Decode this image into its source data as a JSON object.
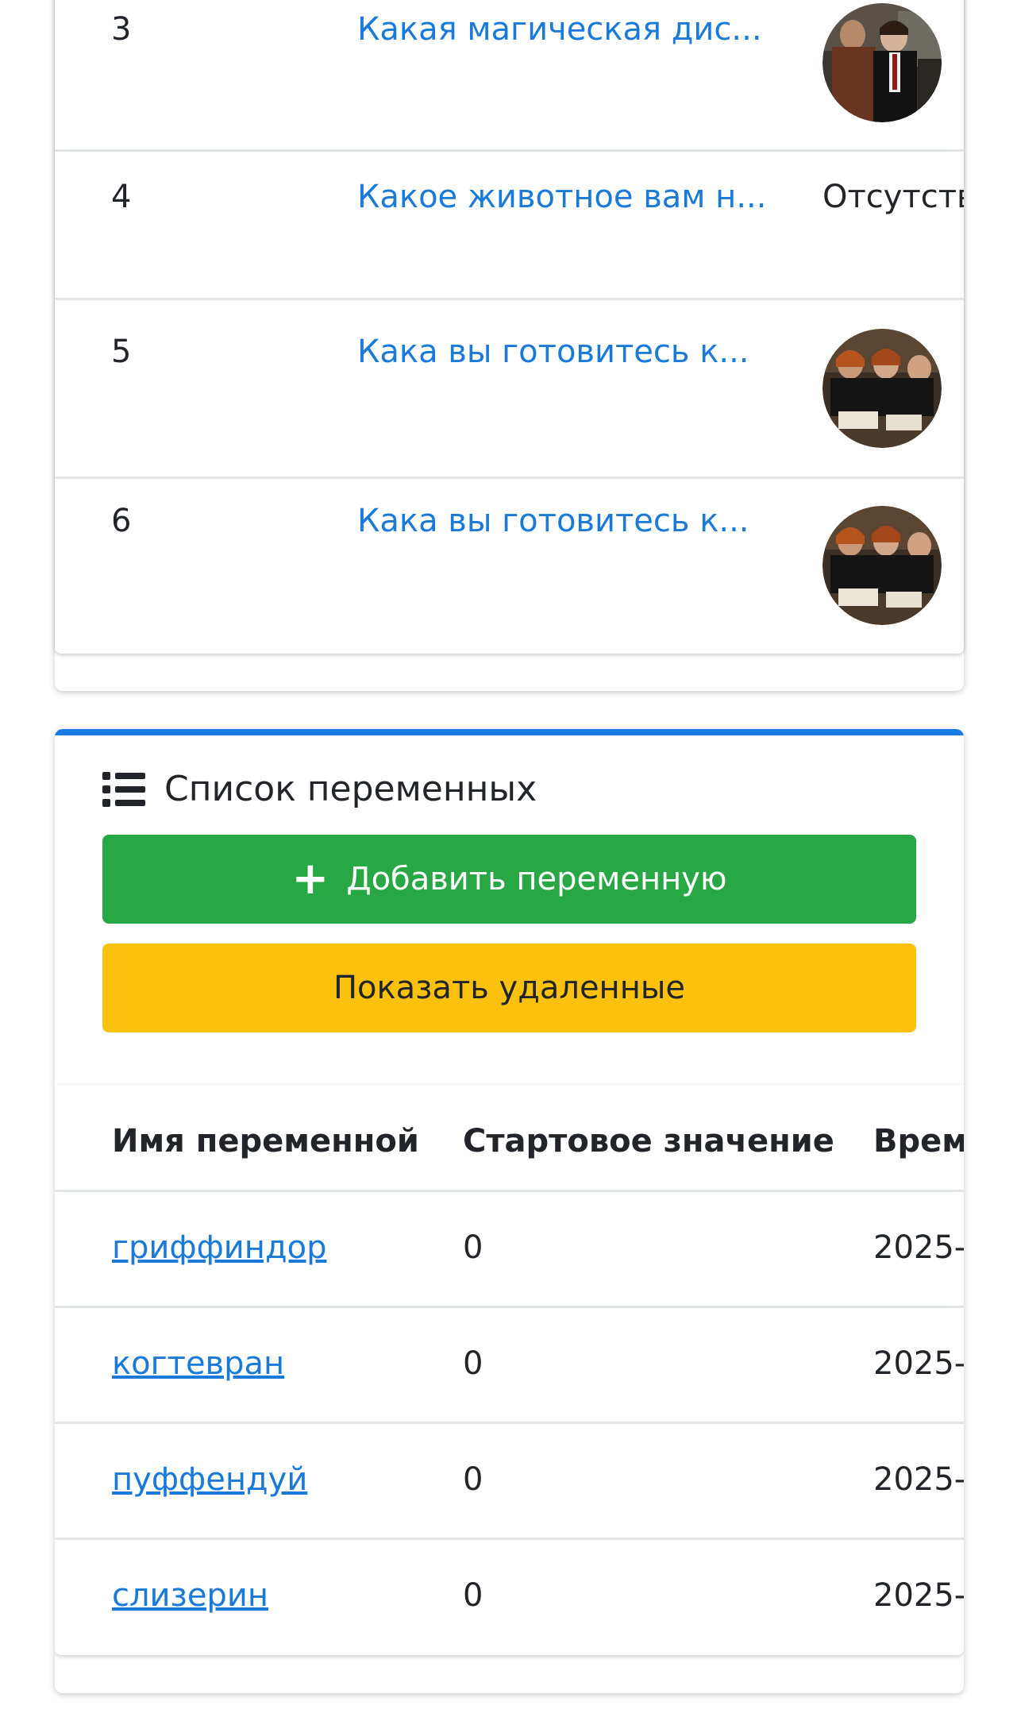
{
  "questions": {
    "rows": [
      {
        "num": "3",
        "title": "Какая магическая дис...",
        "image": "avatar-harry"
      },
      {
        "num": "4",
        "title": "Какое животное вам н...",
        "image_text": "Отсутств"
      },
      {
        "num": "5",
        "title": "Кака вы готовитесь к...",
        "image": "avatar-students"
      },
      {
        "num": "6",
        "title": "Кака вы готовитесь к...",
        "image": "avatar-students"
      }
    ]
  },
  "variables": {
    "title": "Список переменных",
    "icon": "list-icon",
    "add_button": "Добавить переменную",
    "show_deleted_button": "Показать удаленные",
    "columns": [
      "Имя переменной",
      "Стартовое значение",
      "Врем"
    ],
    "rows": [
      {
        "name": "гриффиндор",
        "start": "0",
        "time": "2025-"
      },
      {
        "name": "когтевран",
        "start": "0",
        "time": "2025-"
      },
      {
        "name": "пуффендуй",
        "start": "0",
        "time": "2025-"
      },
      {
        "name": "слизерин",
        "start": "0",
        "time": "2025-"
      }
    ]
  },
  "colors": {
    "accent": "#1b7be4",
    "link": "#1a7ad9",
    "success": "#28a745",
    "warning": "#fcc10c"
  }
}
